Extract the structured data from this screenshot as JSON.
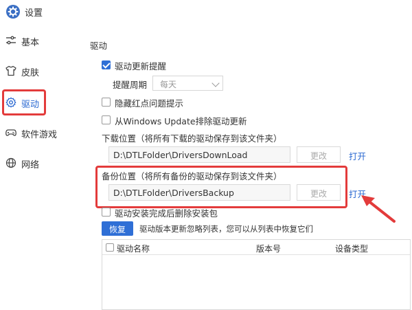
{
  "app": {
    "title": "设置"
  },
  "sidebar": {
    "items": [
      {
        "label": "基本",
        "icon": "sliders-icon"
      },
      {
        "label": "皮肤",
        "icon": "shirt-icon"
      },
      {
        "label": "驱动",
        "icon": "gear-icon",
        "active": true
      },
      {
        "label": "软件游戏",
        "icon": "gamepad-icon"
      },
      {
        "label": "网络",
        "icon": "globe-icon"
      }
    ]
  },
  "driver": {
    "section_title": "驱动",
    "update_reminder": {
      "label": "驱动更新提醒",
      "checked": true
    },
    "reminder_period": {
      "label": "提醒周期",
      "value": "每天"
    },
    "hide_red_dot": {
      "label": "隐藏红点问题提示",
      "checked": false
    },
    "windows_update_exclude": {
      "label": "从Windows  Update排除驱动更新",
      "checked": false
    },
    "download_location": {
      "label": "下载位置（将所有下载的驱动保存到该文件夹）",
      "path": "D:\\DTLFolder\\DriversDownLoad",
      "change_label": "更改",
      "open_label": "打开"
    },
    "backup_location": {
      "label": "备份位置（将所有备份的驱动保存到该文件夹）",
      "path": "D:\\DTLFolder\\DriversBackup",
      "change_label": "更改",
      "open_label": "打开"
    },
    "delete_after_install": {
      "label": "驱动安装完成后删除安装包",
      "checked": false
    },
    "restore": {
      "button_label": "恢复",
      "description": "驱动版本更新忽略列表，您可以从列表中恢复它们"
    },
    "ignore_table": {
      "columns": [
        "驱动名称",
        "版本号",
        "设备类型"
      ],
      "rows": []
    }
  },
  "colors": {
    "accent": "#2f6fd6",
    "annotation": "#e33b3b",
    "link": "#2a68d1"
  }
}
